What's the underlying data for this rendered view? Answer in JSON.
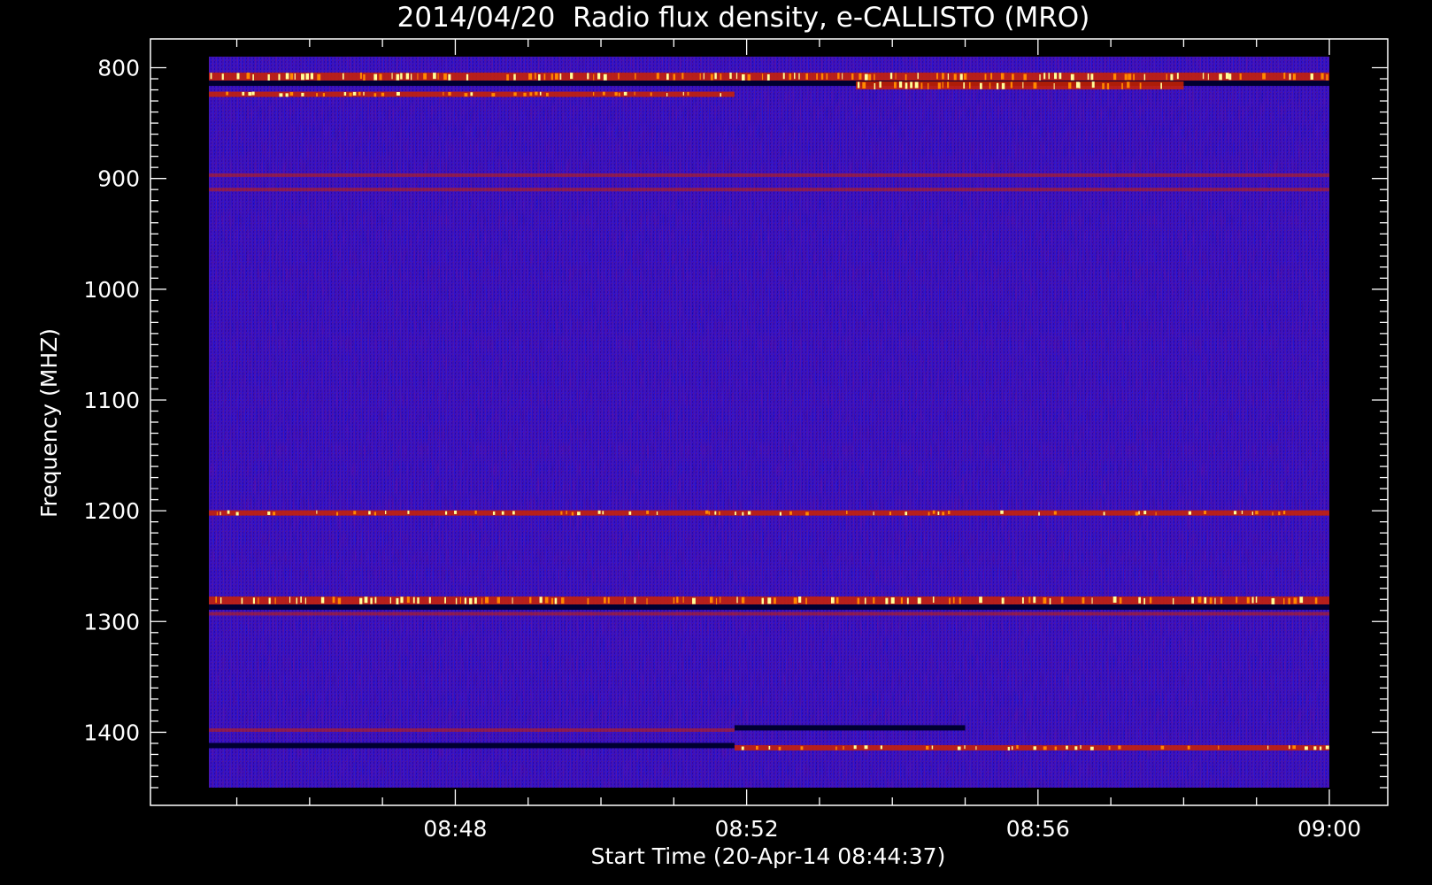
{
  "chart_data": {
    "type": "heatmap",
    "title": "2014/04/20  Radio flux density, e-CALLISTO (MRO)",
    "xlabel": "Start Time (20-Apr-14 08:44:37)",
    "ylabel": "Frequency (MHZ)",
    "x_axis": {
      "unit": "time (UT)",
      "range": [
        "08:44:37",
        "09:00:00"
      ],
      "major_ticks": [
        "08:48",
        "08:52",
        "08:56",
        "09:00"
      ],
      "minor_tick_interval_s": 60
    },
    "y_axis": {
      "unit": "MHz",
      "range": [
        1450,
        790
      ],
      "inverted": true,
      "major_ticks": [
        "800",
        "900",
        "1000",
        "1100",
        "1200",
        "1300",
        "1400"
      ],
      "minor_tick_interval": 10
    },
    "colormap": {
      "low": "#000030",
      "background": "#1a1aee",
      "mid": "#cc2200",
      "high": "#ffff99"
    },
    "emission_bands": [
      {
        "freq_mhz": 808,
        "intensity": "high",
        "time_start": "08:44:37",
        "time_end": "09:00:00"
      },
      {
        "freq_mhz": 816,
        "intensity": "high",
        "time_start": "08:53:30",
        "time_end": "08:58:00"
      },
      {
        "freq_mhz": 824,
        "intensity": "medium",
        "time_start": "08:44:37",
        "time_end": "08:51:50"
      },
      {
        "freq_mhz": 897,
        "intensity": "low",
        "time_start": "08:44:37",
        "time_end": "09:00:00"
      },
      {
        "freq_mhz": 910,
        "intensity": "low",
        "time_start": "08:44:37",
        "time_end": "09:00:00"
      },
      {
        "freq_mhz": 1202,
        "intensity": "medium",
        "time_start": "08:44:37",
        "time_end": "09:00:00"
      },
      {
        "freq_mhz": 1281,
        "intensity": "high",
        "time_start": "08:44:37",
        "time_end": "09:00:00"
      },
      {
        "freq_mhz": 1293,
        "intensity": "low",
        "time_start": "08:44:37",
        "time_end": "09:00:00"
      },
      {
        "freq_mhz": 1398,
        "intensity": "low",
        "time_start": "08:44:37",
        "time_end": "08:51:50"
      },
      {
        "freq_mhz": 1414,
        "intensity": "medium",
        "time_start": "08:51:50",
        "time_end": "09:00:00"
      }
    ],
    "dark_bands": [
      {
        "freq_mhz": 1412,
        "time_start": "08:44:37",
        "time_end": "08:51:50"
      },
      {
        "freq_mhz": 1396,
        "time_start": "08:51:50",
        "time_end": "08:55:00"
      },
      {
        "freq_mhz": 1287,
        "time_start": "08:44:37",
        "time_end": "09:00:00"
      },
      {
        "freq_mhz": 814,
        "time_start": "08:44:37",
        "time_end": "09:00:00"
      }
    ]
  }
}
